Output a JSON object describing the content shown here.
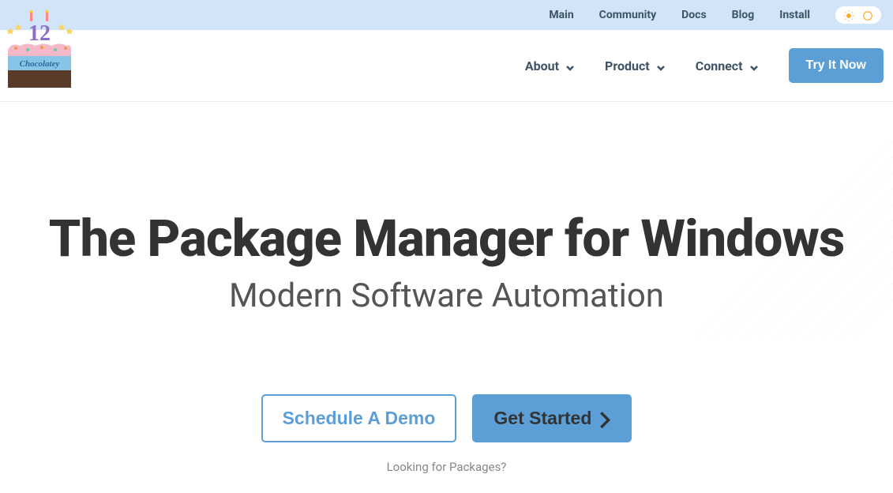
{
  "topbar": {
    "links": [
      {
        "label": "Main"
      },
      {
        "label": "Community"
      },
      {
        "label": "Docs"
      },
      {
        "label": "Blog"
      },
      {
        "label": "Install"
      }
    ]
  },
  "nav": {
    "items": [
      {
        "label": "About"
      },
      {
        "label": "Product"
      },
      {
        "label": "Connect"
      }
    ],
    "cta": "Try It Now"
  },
  "hero": {
    "title": "The Package Manager for Windows",
    "subtitle": "Modern Software Automation",
    "demo_btn": "Schedule A Demo",
    "start_btn": "Get Started",
    "packages_link": "Looking for Packages?"
  },
  "logo": {
    "number": "12",
    "brand": "Chocolatey"
  }
}
